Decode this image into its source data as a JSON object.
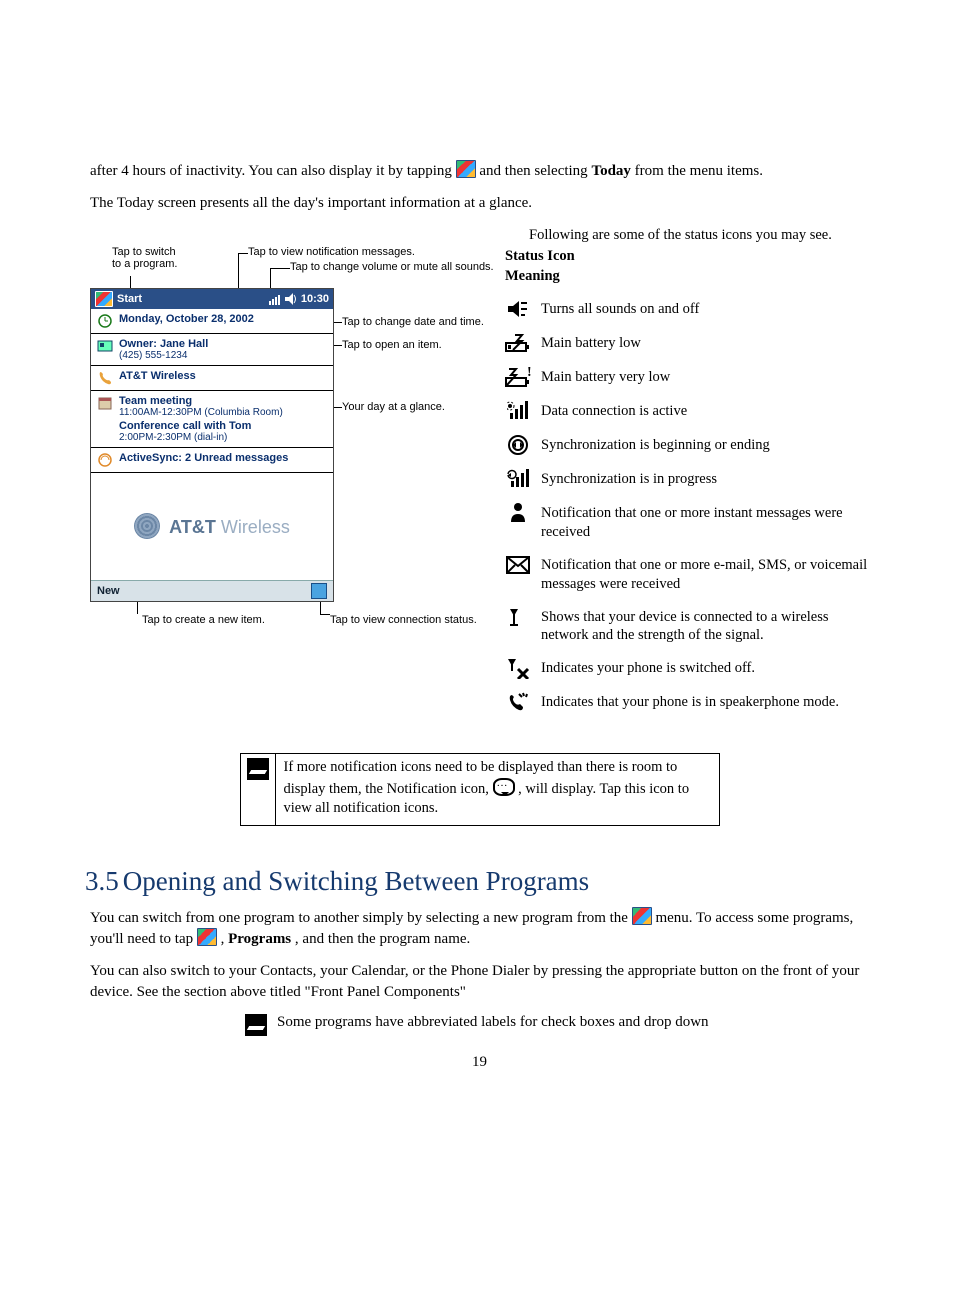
{
  "intro": {
    "para1_a": "after 4 hours of inactivity.  You can also display it by tapping ",
    "para1_b": " and then selecting ",
    "para1_bold": "Today",
    "para1_c": " from the menu items.",
    "para2": "The Today screen presents all the day's important information at a glance."
  },
  "callouts": {
    "switch_prog": "Tap to switch\nto a program.",
    "notif": "Tap to view notification messages.",
    "volume": "Tap to change volume or mute all sounds.",
    "datetime": "Tap to change date and time.",
    "open_item": "Tap to open an item.",
    "glance": "Your day at a glance.",
    "new_item": "Tap to create a new item.",
    "conn": "Tap to view connection status."
  },
  "today": {
    "start": "Start",
    "clock": "10:30",
    "date": "Monday, October 28, 2002",
    "owner": "Owner: Jane Hall",
    "owner_phone": "(425) 555-1234",
    "carrier": "AT&T Wireless",
    "meeting1": "Team meeting",
    "meeting1_sub": "11:00AM-12:30PM (Columbia Room)",
    "meeting2": "Conference call with Tom",
    "meeting2_sub": "2:00PM-2:30PM (dial-in)",
    "sync": "ActiveSync: 2 Unread messages",
    "brand": "AT&T Wireless",
    "new": "New"
  },
  "right": {
    "lead": "Following are some of the status icons you may see.",
    "header1": "Status Icon",
    "header2": "Meaning"
  },
  "legend": [
    {
      "id": "sound-toggle-icon",
      "text": "Turns all sounds on and off"
    },
    {
      "id": "battery-low-icon",
      "text": "Main battery low"
    },
    {
      "id": "battery-very-low-icon",
      "text": "Main battery very low"
    },
    {
      "id": "data-active-icon",
      "text": "Data connection is active"
    },
    {
      "id": "sync-begin-icon",
      "text": "Synchronization is beginning or ending"
    },
    {
      "id": "sync-progress-icon",
      "text": "Synchronization is in progress"
    },
    {
      "id": "im-notification-icon",
      "text": "Notification that one or more instant messages were received"
    },
    {
      "id": "mail-notification-icon",
      "text": "Notification that one or more e-mail, SMS, or voicemail messages were received"
    },
    {
      "id": "signal-icon",
      "text": "Shows that your device is connected to a wireless network and the strength of the signal."
    },
    {
      "id": "phone-off-icon",
      "text": "Indicates your phone is switched off."
    },
    {
      "id": "speakerphone-icon",
      "text": "Indicates that your phone is in speakerphone mode."
    }
  ],
  "note1": {
    "a": "If more notification icons need to be displayed than there is room to display them, the Notification icon, ",
    "b": ", will display. Tap this icon to view all notification icons."
  },
  "section": {
    "num": "3.5",
    "title": "Opening and Switching Between Programs"
  },
  "body2": {
    "p1a": "You can switch from one program to another simply by selecting a new program from the ",
    "p1b": " menu.  To access some programs, you'll need to tap ",
    "p1c": ", ",
    "p1bold": "Programs",
    "p1d": ", and then the program name.",
    "p2": "You can also switch to your Contacts, your Calendar, or the Phone Dialer by pressing the appropriate button on the front of your device.  See the section above titled \"Front Panel Components\"",
    "note": "Some programs have abbreviated labels for check boxes and drop down"
  },
  "pagenum": "19"
}
